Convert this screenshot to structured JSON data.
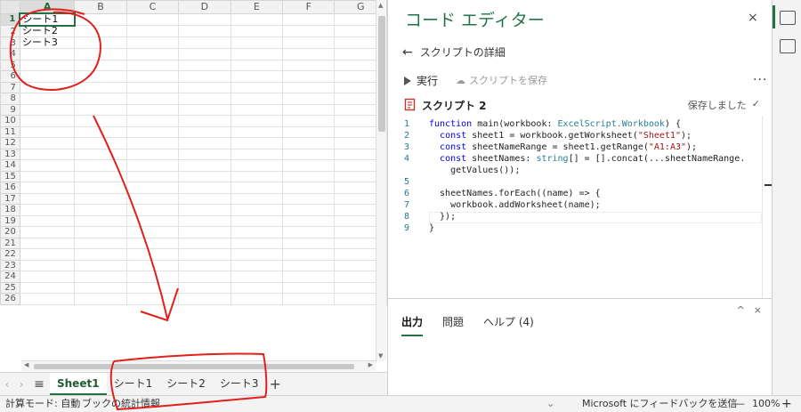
{
  "grid": {
    "columns": [
      "A",
      "B",
      "C",
      "D",
      "E",
      "F",
      "G"
    ],
    "rows": [
      "1",
      "2",
      "3",
      "4",
      "5",
      "6",
      "7",
      "8",
      "9",
      "10",
      "11",
      "12",
      "13",
      "14",
      "15",
      "16",
      "17",
      "18",
      "19",
      "20",
      "21",
      "22",
      "23",
      "24",
      "25",
      "26"
    ],
    "cells": {
      "A1": "シート1",
      "A2": "シート2",
      "A3": "シート3"
    }
  },
  "sheet_tabs": {
    "tabs": [
      "Sheet1",
      "シート1",
      "シート2",
      "シート3"
    ],
    "active": "Sheet1",
    "add": "+",
    "menu": "≡"
  },
  "status_bar": {
    "calc_mode": "計算モード: 自動",
    "workbook_stats": "ブックの統計情報",
    "feedback": "Microsoft にフィードバックを送信",
    "zoom_minus": "—",
    "zoom": "100%",
    "zoom_plus": "+"
  },
  "editor_pane": {
    "title": "コード エディター",
    "close": "×",
    "back_label": "スクリプトの詳細",
    "run_label": "実行",
    "save_label": "スクリプトを保存",
    "more": "...",
    "script_name": "スクリプト 2",
    "saved_text": "保存しました",
    "code_lines": [
      {
        "n": "1",
        "text": "function main(workbook: ExcelScript.Workbook) {"
      },
      {
        "n": "2",
        "text": "  const sheet1 = workbook.getWorksheet(\"Sheet1\");"
      },
      {
        "n": "3",
        "text": "  const sheetNameRange = sheet1.getRange(\"A1:A3\");"
      },
      {
        "n": "4",
        "text": "  const sheetNames: string[] = [].concat(...sheetNameRange."
      },
      {
        "n": "",
        "text": "    getValues());"
      },
      {
        "n": "5",
        "text": ""
      },
      {
        "n": "6",
        "text": "  sheetNames.forEach((name) => {"
      },
      {
        "n": "7",
        "text": "    workbook.addWorksheet(name);"
      },
      {
        "n": "8",
        "text": "  });"
      },
      {
        "n": "9",
        "text": "}"
      }
    ],
    "bottom_tabs": [
      "出力",
      "問題",
      "ヘルプ (4)"
    ],
    "bottom_active": "出力",
    "bottom_ctl": [
      "^",
      "×"
    ]
  },
  "colors": {
    "accent": "#217346",
    "annotation": "#e0201c"
  }
}
